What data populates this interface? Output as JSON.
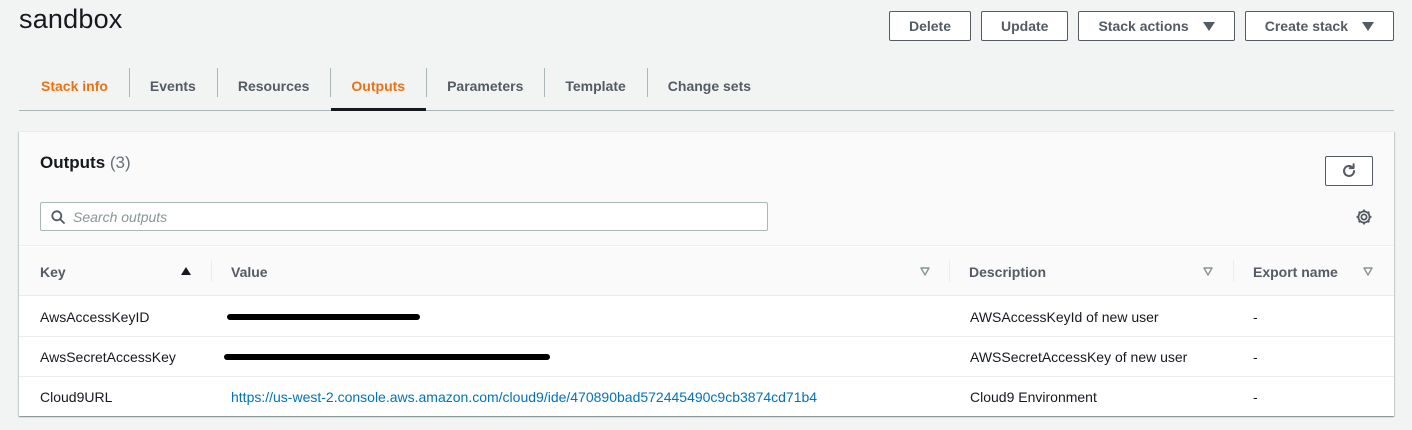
{
  "stack": {
    "name": "sandbox"
  },
  "actions": {
    "delete": "Delete",
    "update": "Update",
    "stack_actions": "Stack actions",
    "create_stack": "Create stack"
  },
  "tabs": [
    "Stack info",
    "Events",
    "Resources",
    "Outputs",
    "Parameters",
    "Template",
    "Change sets"
  ],
  "outputs": {
    "title": "Outputs",
    "count": "(3)",
    "search_placeholder": "Search outputs",
    "columns": {
      "key": "Key",
      "value": "Value",
      "description": "Description",
      "export_name": "Export name"
    },
    "rows": [
      {
        "key": "AwsAccessKeyID",
        "value": "",
        "value_redacted": true,
        "description": "AWSAccessKeyId of new user",
        "export_name": "-"
      },
      {
        "key": "AwsSecretAccessKey",
        "value": "",
        "value_redacted": true,
        "description": "AWSSecretAccessKey of new user",
        "export_name": "-"
      },
      {
        "key": "Cloud9URL",
        "value": "https://us-west-2.console.aws.amazon.com/cloud9/ide/470890bad572445490c9cb3874cd71b4",
        "value_redacted": false,
        "description": "Cloud9 Environment",
        "export_name": "-"
      }
    ]
  },
  "colors": {
    "accent": "#ec7211",
    "link": "#0073bb",
    "text": "#16191f",
    "muted": "#545b64"
  }
}
